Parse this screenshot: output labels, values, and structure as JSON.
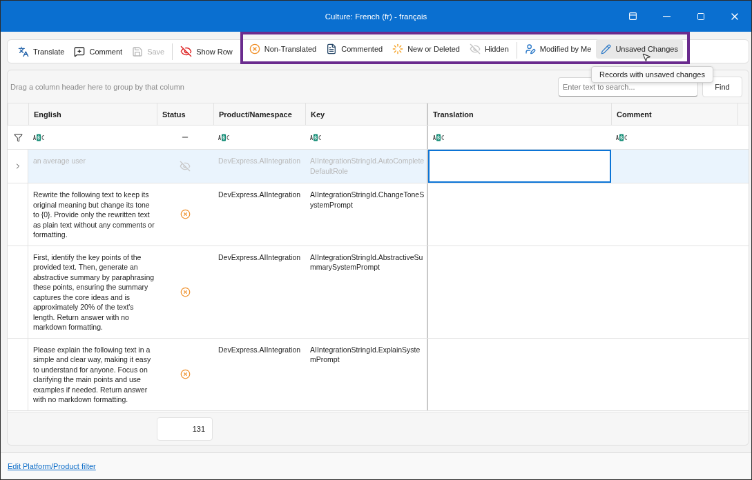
{
  "window": {
    "title": "Culture: French (fr) - français"
  },
  "toolbar": {
    "actions": [
      {
        "label": "Translate",
        "disabled": false
      },
      {
        "label": "Comment",
        "disabled": false
      },
      {
        "label": "Save",
        "disabled": true
      },
      {
        "label": "Show Row",
        "disabled": false
      }
    ],
    "filters": {
      "highlighted": true,
      "groups": [
        [
          {
            "label": "Non-Translated",
            "selected": false
          },
          {
            "label": "Commented",
            "selected": false
          },
          {
            "label": "New or Deleted",
            "selected": false
          },
          {
            "label": "Hidden",
            "selected": false
          }
        ],
        [
          {
            "label": "Modified by Me",
            "selected": false
          },
          {
            "label": "Unsaved Changes",
            "selected": true
          }
        ]
      ],
      "tooltip": "Records with unsaved changes"
    }
  },
  "group_panel": {
    "placeholder": "Drag a column header here to group by that column"
  },
  "search": {
    "placeholder": "Enter text to search...",
    "button": "Find"
  },
  "table": {
    "columns": [
      "English",
      "Status",
      "Product/Namespace",
      "Key",
      "Translation",
      "Comment"
    ],
    "rows": [
      {
        "english": "an average user",
        "kind": "hidden",
        "product": "DevExpress.AIIntegration",
        "key": "AIIntegrationStringId.AutoCompleteDefaultRole",
        "selected": true
      },
      {
        "english": "Rewrite the following text to keep its original meaning but change its tone to {0}. Provide only the rewritten text as plain text without any comments or formatting.",
        "kind": "non_translated",
        "product": "DevExpress.AIIntegration",
        "key": "AIIntegrationStringId.ChangeToneSystemPrompt",
        "selected": false
      },
      {
        "english": "First, identify the key points of the provided text. Then, generate an abstractive summary by paraphrasing these points, ensuring the summary captures the core ideas and is approximately 20% of the text's length. Return answer with no markdown formatting.",
        "kind": "non_translated",
        "product": "DevExpress.AIIntegration",
        "key": "AIIntegrationStringId.AbstractiveSummarySystemPrompt",
        "selected": false
      },
      {
        "english": "Please explain the following text in a simple and clear way, making it easy to understand for anyone. Focus on clarifying the main points and use examples if needed. Return answer with no markdown formatting.",
        "kind": "non_translated",
        "product": "DevExpress.AIIntegration",
        "key": "AIIntegrationStringId.ExplainSystemPrompt",
        "selected": false
      }
    ],
    "summary": "131"
  },
  "footer": {
    "link": "Edit Platform/Product filter"
  }
}
